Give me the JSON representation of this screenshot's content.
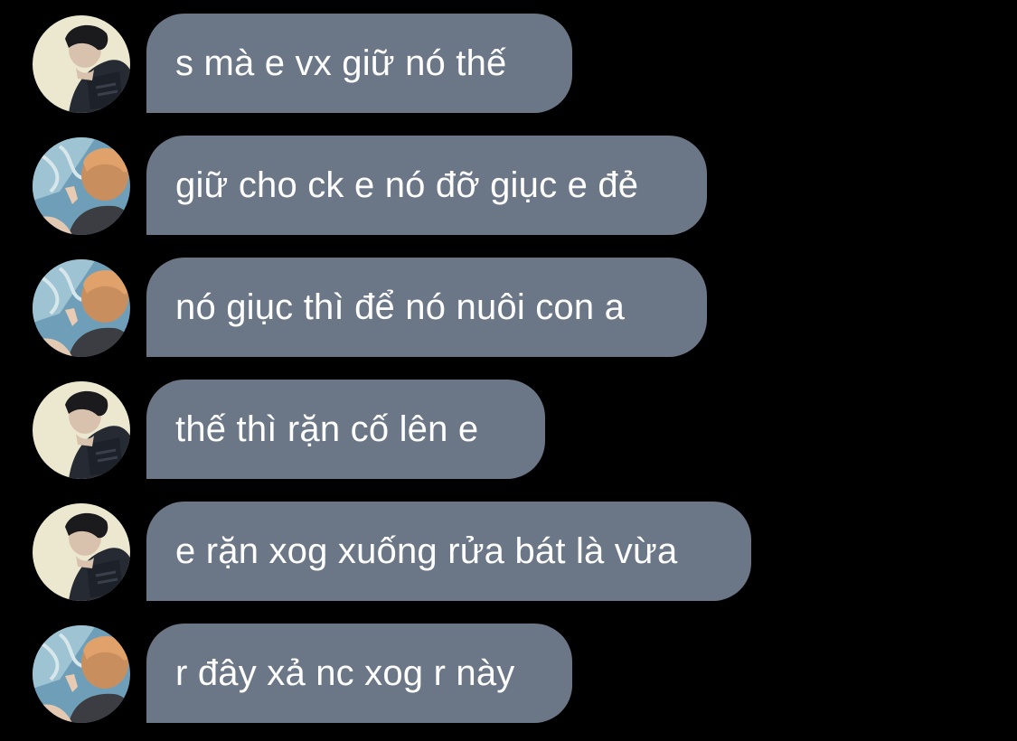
{
  "colors": {
    "background": "#000000",
    "bubble": "#6b7786",
    "text": "#ffffff"
  },
  "messages": [
    {
      "text": "s mà e vx giữ nó thế",
      "avatar": "avatar-a-icon"
    },
    {
      "text": "giữ cho ck e nó đỡ giục e đẻ",
      "avatar": "avatar-b-icon"
    },
    {
      "text": "nó giục thì để nó nuôi con a",
      "avatar": "avatar-b-icon"
    },
    {
      "text": "thế thì rặn cố lên e",
      "avatar": "avatar-a-icon"
    },
    {
      "text": "e rặn xog xuống rửa bát là vừa",
      "avatar": "avatar-a-icon"
    },
    {
      "text": "r đây xả nc xog r này",
      "avatar": "avatar-b-icon"
    }
  ]
}
